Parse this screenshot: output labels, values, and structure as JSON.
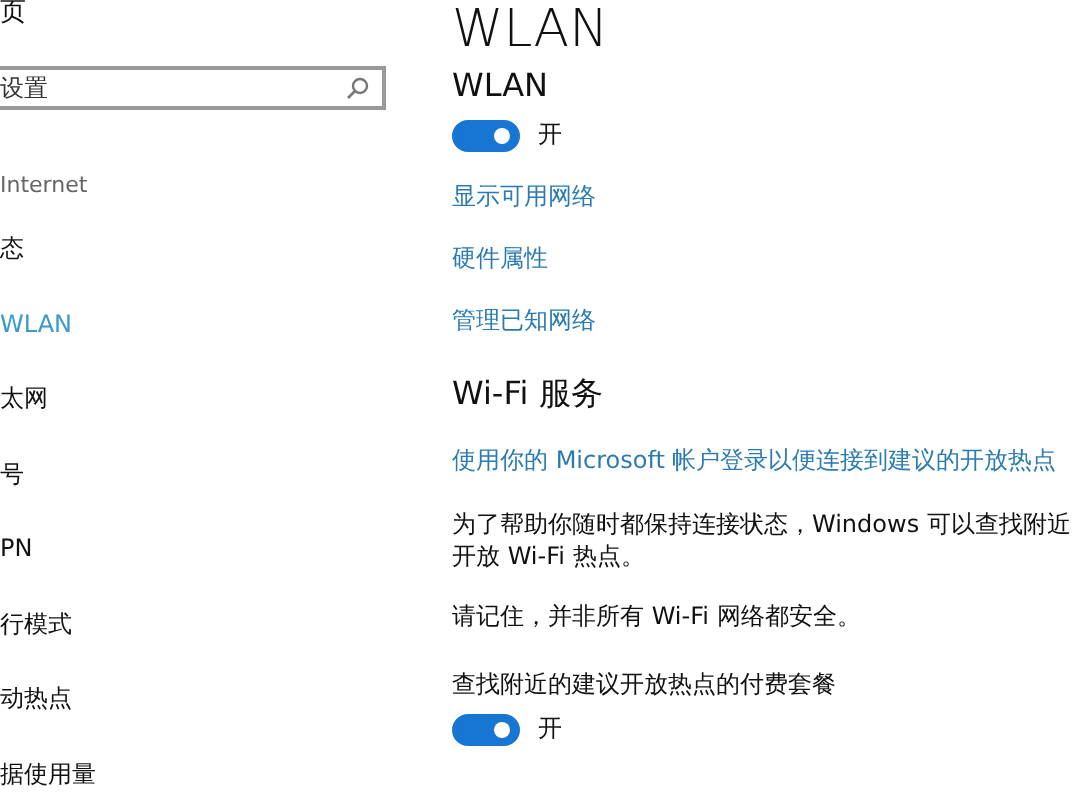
{
  "sidebar": {
    "home": "页",
    "search": {
      "placeholder": "设置"
    },
    "group": "Internet",
    "items": [
      {
        "label": "态",
        "selected": false
      },
      {
        "label": "WLAN",
        "selected": true
      },
      {
        "label": "太网",
        "selected": false
      },
      {
        "label": "号",
        "selected": false
      },
      {
        "label": "PN",
        "selected": false
      },
      {
        "label": "行模式",
        "selected": false
      },
      {
        "label": "动热点",
        "selected": false
      },
      {
        "label": "据使用量",
        "selected": false
      }
    ]
  },
  "content": {
    "title": "WLAN",
    "wlan": {
      "label": "WLAN",
      "on": true,
      "state": "开"
    },
    "links": [
      "显示可用网络",
      "硬件属性",
      "管理已知网络"
    ],
    "wifi_services": {
      "heading": "Wi-Fi 服务",
      "signin_link": "使用你的 Microsoft 帐户登录以便连接到建议的开放热点",
      "description": [
        "为了帮助你随时都保持连接状态，Windows 可以查找附近",
        "开放 Wi-Fi 热点。"
      ],
      "note": "请记住，并非所有 Wi-Fi 网络都安全。",
      "paid_plans": {
        "label": "查找附近的建议开放热点的付费套餐",
        "on": true,
        "state": "开"
      }
    }
  }
}
